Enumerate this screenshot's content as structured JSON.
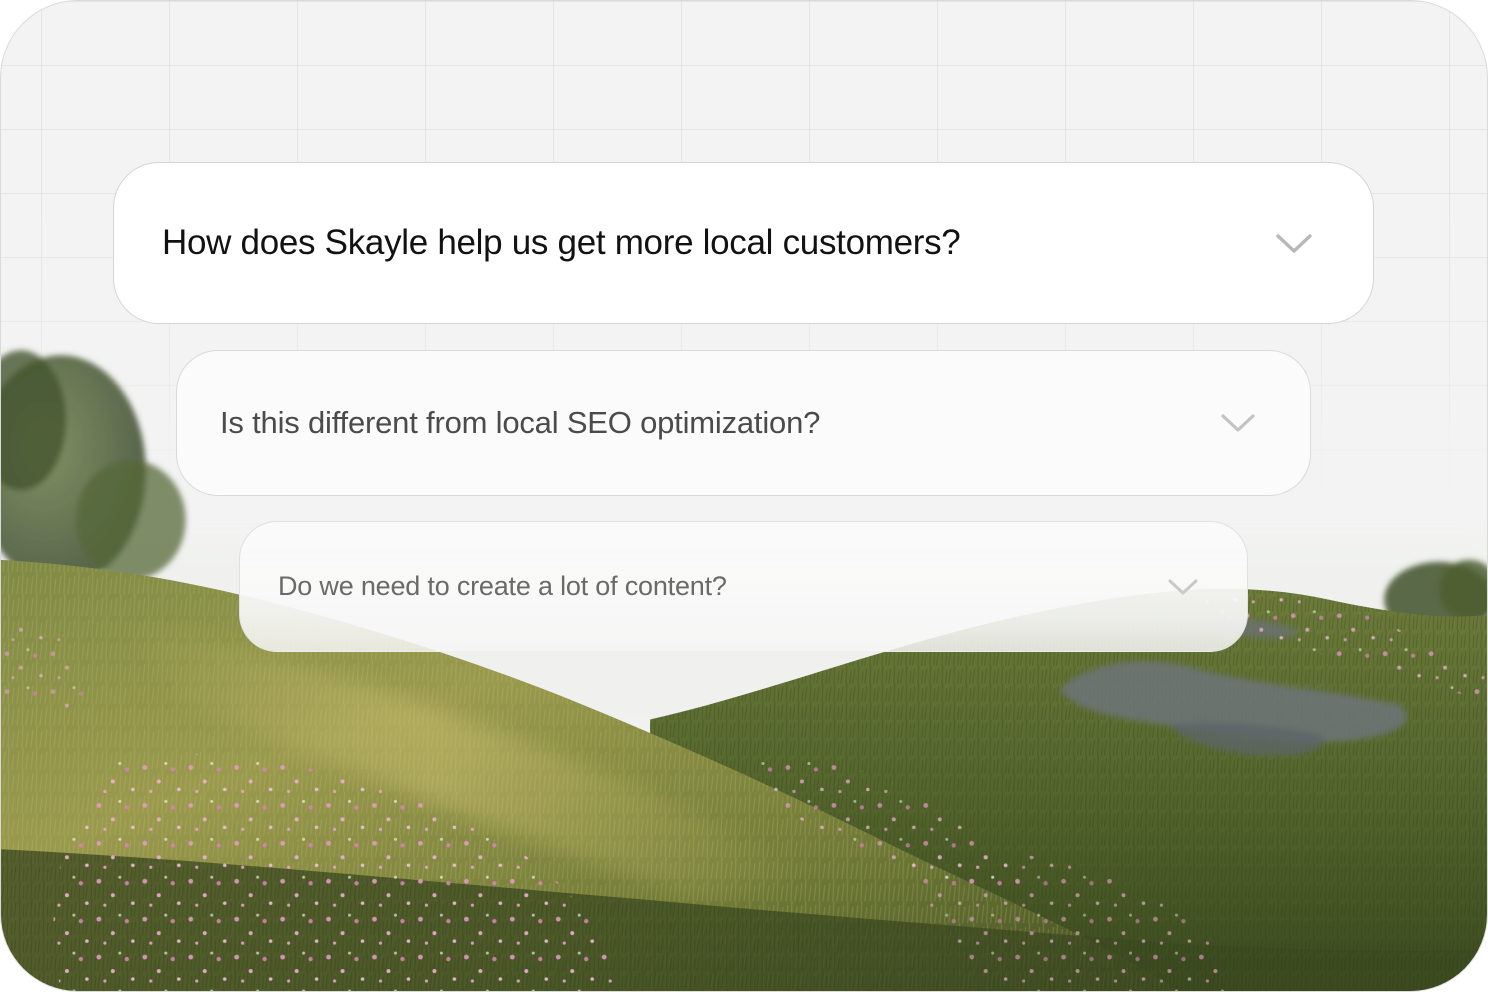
{
  "faq": {
    "items": [
      {
        "question": "How does Skayle help us get more local customers?",
        "icon": "chevron-down-icon"
      },
      {
        "question": "Is this different from local SEO optimization?",
        "icon": "chevron-down-icon"
      },
      {
        "question": "Do we need to create a lot of content?",
        "icon": "chevron-down-icon"
      }
    ]
  },
  "colors": {
    "background": "#f3f3f3",
    "card_primary": "#ffffff",
    "card_border": "#d4d4d4",
    "text_primary": "#121212",
    "text_secondary": "#4b4b4b",
    "text_tertiary": "#6a6a6a",
    "grass": "#5b6e2c",
    "flowers": "#e38fc0"
  }
}
